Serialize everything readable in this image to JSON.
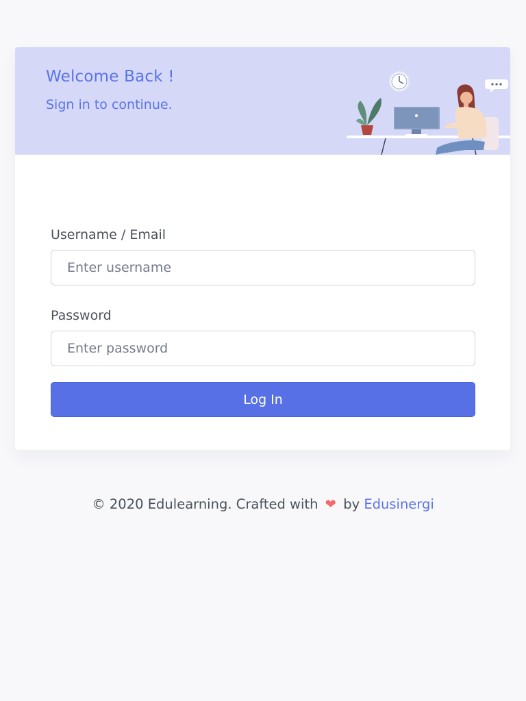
{
  "card": {
    "title": "Welcome Back !",
    "subtitle": "Sign in to continue.",
    "illustration_icon": "woman-at-desk-illustration"
  },
  "form": {
    "username_label": "Username / Email",
    "username_placeholder": "Enter username",
    "username_value": "",
    "password_label": "Password",
    "password_placeholder": "Enter password",
    "password_value": "",
    "submit_label": "Log In"
  },
  "footer": {
    "prefix": "© 2020 Edulearning. Crafted with",
    "heart_icon": "heart-icon",
    "by": "by",
    "brand": "Edusinergi"
  },
  "colors": {
    "accent": "#5b73e8",
    "header_bg": "#d5d9f7",
    "page_bg": "#f8f8fb",
    "heart": "#f46a6a"
  }
}
